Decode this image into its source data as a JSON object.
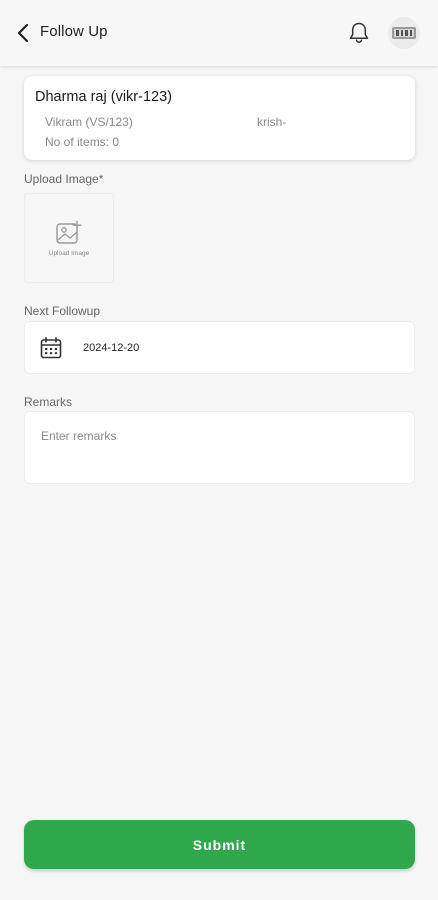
{
  "header": {
    "title": "Follow Up",
    "back_icon": "chevron-left-icon",
    "notification_icon": "bell-icon",
    "avatar_icon": "avatar"
  },
  "card": {
    "name": "Dharma raj (vikr-123)",
    "vendor": "Vikram (VS/123)",
    "ref": "krish-",
    "items": "No of items: 0"
  },
  "upload": {
    "label": "Upload Image*",
    "button_text": "Upload Image",
    "icon": "image-plus-icon"
  },
  "followup": {
    "label": "Next Followup",
    "date": "2024-12-20",
    "icon": "calendar-icon"
  },
  "remarks": {
    "label": "Remarks",
    "placeholder": "Enter remarks",
    "value": ""
  },
  "submit": {
    "label": "Submit"
  },
  "colors": {
    "accent": "#2ea84a",
    "background": "#f6f6f6",
    "card": "#ffffff"
  }
}
